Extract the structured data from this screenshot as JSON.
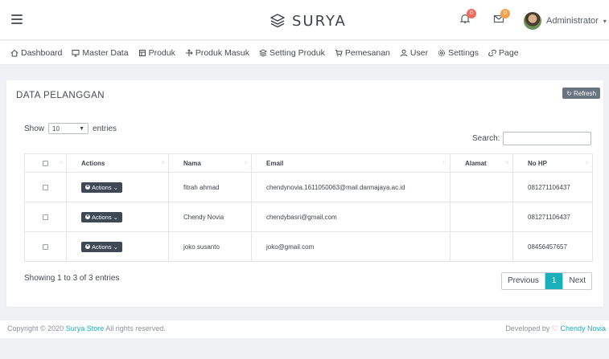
{
  "brand": {
    "name": "SURYA",
    "icon": "layers-logo-icon"
  },
  "header": {
    "notifications": {
      "icon": "bell-icon",
      "count": "0",
      "color": "#f06c5e"
    },
    "messages": {
      "icon": "mail-icon",
      "count": "0",
      "color": "#f5a04b"
    },
    "user": {
      "name": "Administrator",
      "icon": "avatar"
    }
  },
  "menu": [
    {
      "label": "Dashboard",
      "icon": "home-icon"
    },
    {
      "label": "Master Data",
      "icon": "monitor-icon"
    },
    {
      "label": "Produk",
      "icon": "book-icon"
    },
    {
      "label": "Produk Masuk",
      "icon": "plus-move-icon"
    },
    {
      "label": "Setting Produk",
      "icon": "layers-icon"
    },
    {
      "label": "Pemesanan",
      "icon": "cart-icon"
    },
    {
      "label": "User",
      "icon": "user-icon"
    },
    {
      "label": "Settings",
      "icon": "gear-icon"
    },
    {
      "label": "Page",
      "icon": "link-icon"
    }
  ],
  "card": {
    "title": "DATA PELANGGAN",
    "refresh_label": "Refresh"
  },
  "length": {
    "show_label": "Show",
    "selected": "10",
    "entries_label": "entries"
  },
  "search": {
    "label": "Search:",
    "value": "",
    "placeholder": ""
  },
  "table": {
    "columns": [
      "",
      "Actions",
      "Nama",
      "Email",
      "Alamat",
      "No HP"
    ],
    "rows": [
      {
        "action": "Actions",
        "nama": "fitrah ahmad",
        "email": "chendynovia.1611050063@mail.darmajaya.ac.id",
        "alamat": "",
        "hp": "081271106437"
      },
      {
        "action": "Actions",
        "nama": "Chendy Novia",
        "email": "chendybasri@gmail.com",
        "alamat": "",
        "hp": "081271106437"
      },
      {
        "action": "Actions",
        "nama": "joko susanto",
        "email": "joko@gmail.com",
        "alamat": "",
        "hp": "08456457657"
      }
    ]
  },
  "info": "Showing 1 to 3 of 3 entries",
  "pagination": {
    "previous": "Previous",
    "current": "1",
    "next": "Next"
  },
  "footer": {
    "copyright_prefix": "Copyright © 2020",
    "store": "Surya Store",
    "rights": "All rights reserved.",
    "developed_by": "Developed by",
    "developer": "Chendy Novia"
  },
  "colors": {
    "accent": "#1ab0ba",
    "dark_button": "#3e4954",
    "badge_red": "#f06c5e",
    "badge_orange": "#f5a04b"
  }
}
